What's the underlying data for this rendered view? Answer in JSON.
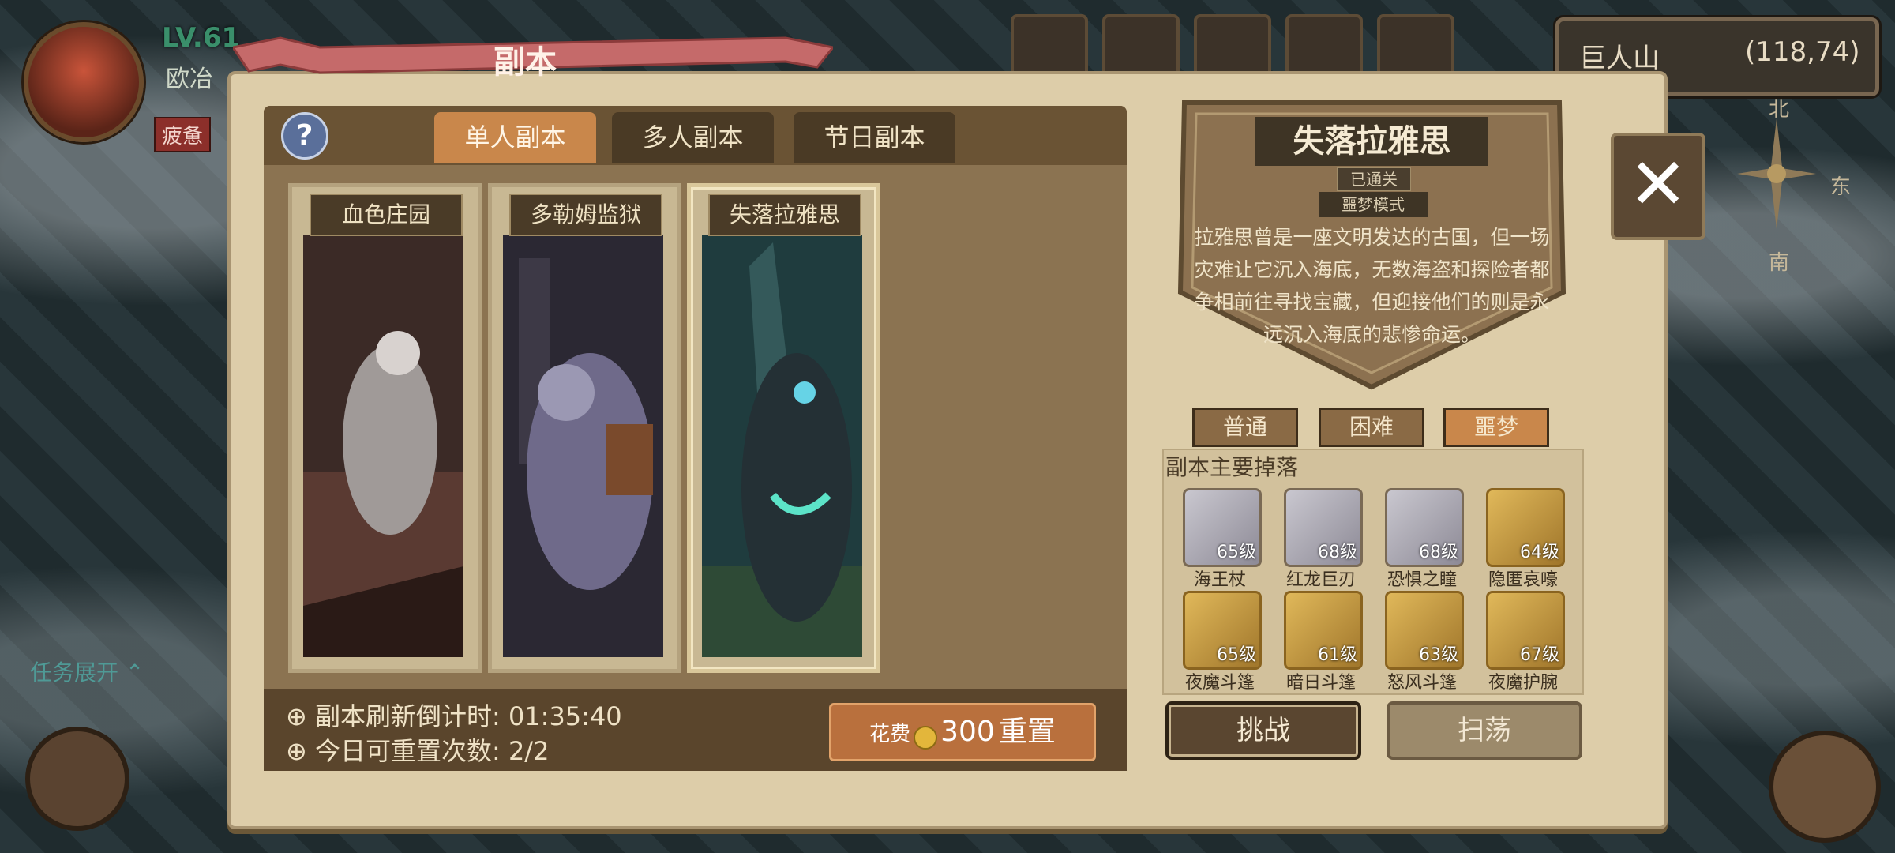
{
  "hud": {
    "level": "LV.61",
    "player_name": "欧冶",
    "status": "疲惫",
    "location": "巨人山",
    "coords": "(118,74)",
    "compass": {
      "n": "北",
      "s": "南",
      "e": "东"
    },
    "task_toggle": "任务展开"
  },
  "panel": {
    "title": "副本",
    "help_icon": "?",
    "tabs": [
      {
        "label": "单人副本",
        "active": true
      },
      {
        "label": "多人副本",
        "active": false
      },
      {
        "label": "节日副本",
        "active": false
      }
    ],
    "dungeons": [
      {
        "name": "血色庄园"
      },
      {
        "name": "多勒姆监狱"
      },
      {
        "name": "失落拉雅思",
        "selected": true
      }
    ],
    "refresh_text": "副本刷新倒计时: 01:35:40",
    "reset_count_text": "今日可重置次数: 2/2",
    "reset_button": {
      "cost_label": "花费",
      "cost": "300",
      "action": "重置"
    }
  },
  "detail": {
    "title": "失落拉雅思",
    "cleared": "已通关",
    "mode": "噩梦模式",
    "description": "拉雅思曾是一座文明发达的古国，但一场灾难让它沉入海底，无数海盗和探险者都争相前往寻找宝藏，但迎接他们的则是永远沉入海底的悲惨命运。",
    "difficulties": [
      {
        "label": "普通",
        "active": false
      },
      {
        "label": "困难",
        "active": false
      },
      {
        "label": "噩梦",
        "active": true
      }
    ],
    "drops_title": "副本主要掉落",
    "drops": [
      {
        "name": "海王杖",
        "level": "65级",
        "rarity": "silver"
      },
      {
        "name": "红龙巨刃",
        "level": "68级",
        "rarity": "silver"
      },
      {
        "name": "恐惧之瞳",
        "level": "68级",
        "rarity": "silver"
      },
      {
        "name": "隐匿哀嚎",
        "level": "64级",
        "rarity": "gold"
      },
      {
        "name": "夜魔斗篷",
        "level": "65级",
        "rarity": "gold"
      },
      {
        "name": "暗日斗篷",
        "level": "61级",
        "rarity": "gold"
      },
      {
        "name": "怒风斗篷",
        "level": "63级",
        "rarity": "gold"
      },
      {
        "name": "夜魔护腕",
        "level": "67级",
        "rarity": "gold"
      }
    ],
    "challenge_label": "挑战",
    "sweep_label": "扫荡",
    "close_icon": "✕"
  }
}
